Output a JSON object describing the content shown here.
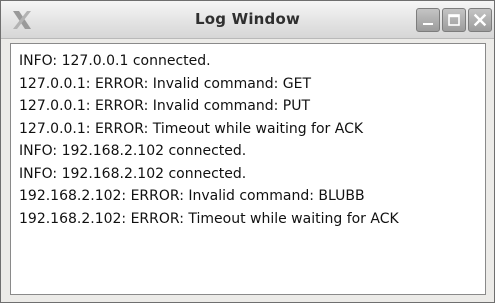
{
  "window": {
    "title": "Log Window",
    "app_icon": "x-logo-icon"
  },
  "controls": {
    "minimize_icon": "minimize-icon",
    "maximize_icon": "maximize-icon",
    "close_icon": "close-icon"
  },
  "log": {
    "lines": [
      "INFO: 127.0.0.1 connected.",
      "127.0.0.1: ERROR: Invalid command: GET",
      "127.0.0.1: ERROR: Invalid command: PUT",
      "127.0.0.1: ERROR: Timeout while waiting for ACK",
      "INFO: 192.168.2.102 connected.",
      "INFO: 192.168.2.102 connected.",
      "192.168.2.102: ERROR: Invalid command: BLUBB",
      "192.168.2.102: ERROR: Timeout while waiting for ACK"
    ]
  }
}
